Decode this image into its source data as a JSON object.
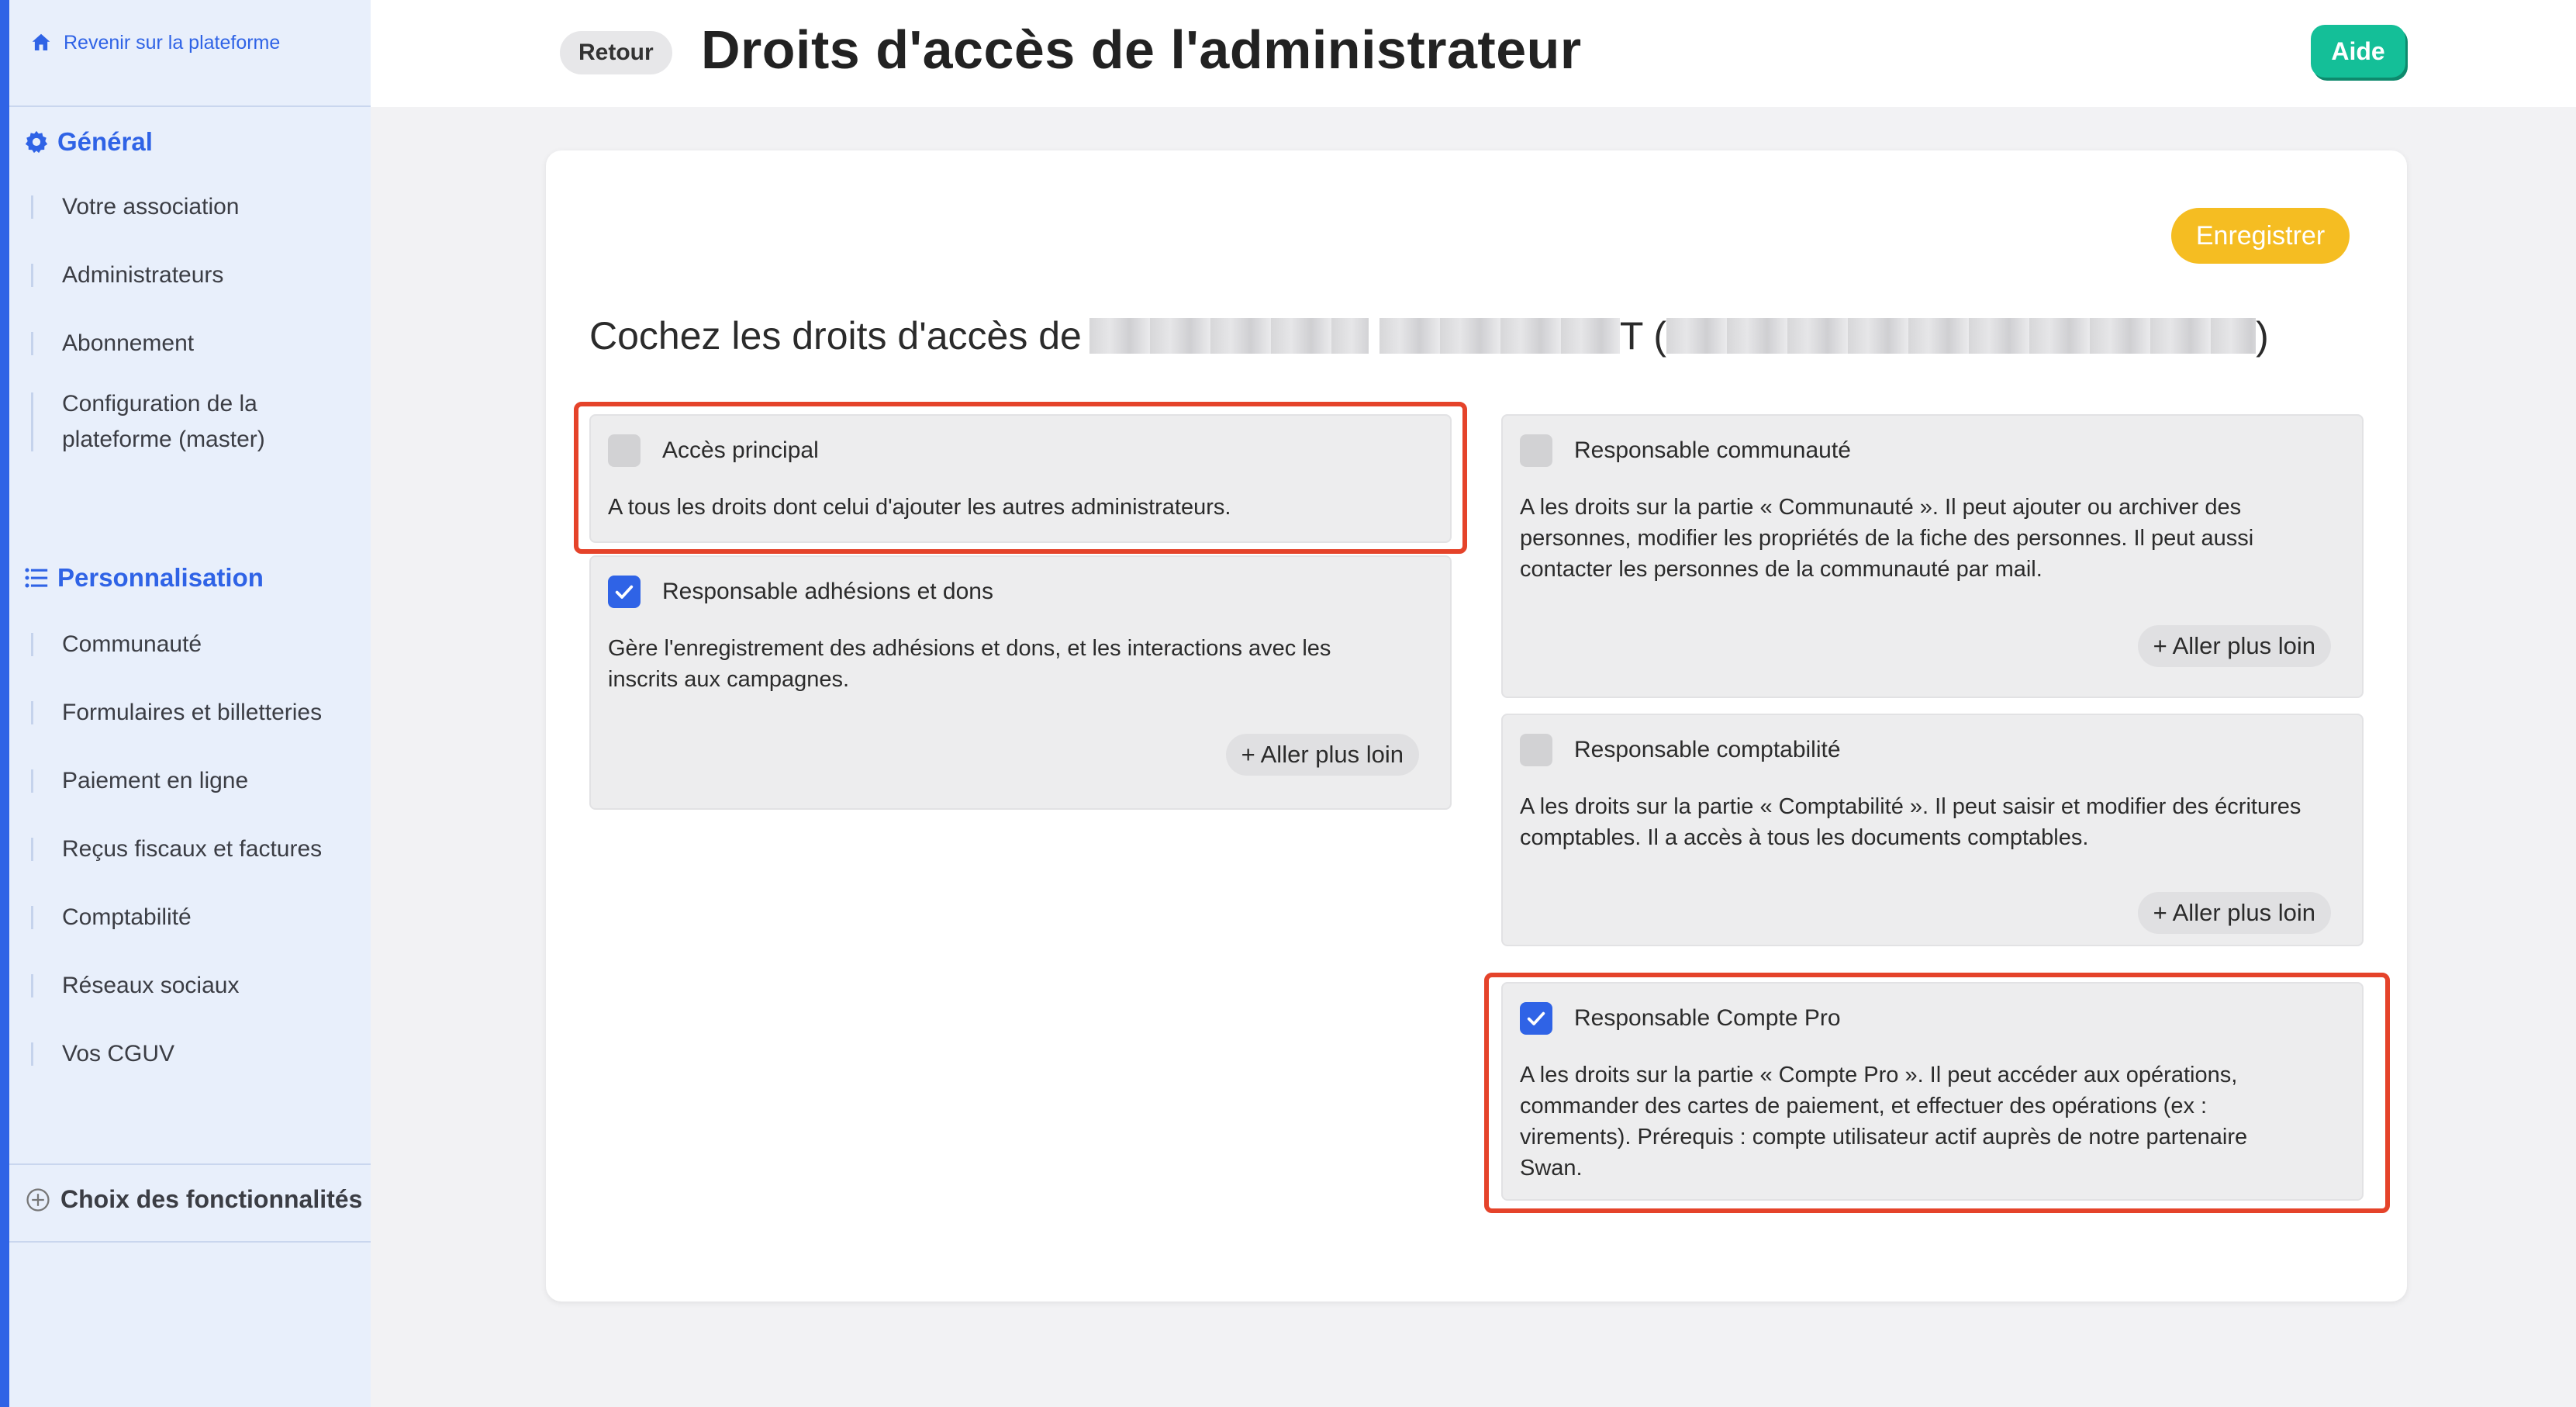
{
  "sidebar": {
    "back_link": "Revenir sur la plateforme",
    "sections": [
      {
        "title": "Général",
        "icon": "gear-icon",
        "items": [
          "Votre association",
          "Administrateurs",
          "Abonnement",
          "Configuration de la plateforme (master)"
        ]
      },
      {
        "title": "Personnalisation",
        "icon": "list-icon",
        "items": [
          "Communauté",
          "Formulaires et billetteries",
          "Paiement en ligne",
          "Reçus fiscaux et factures",
          "Comptabilité",
          "Réseaux sociaux",
          "Vos CGUV"
        ]
      }
    ],
    "features_label": "Choix des fonctionnalités"
  },
  "header": {
    "back_button": "Retour",
    "title": "Droits d'accès de l'administrateur",
    "help_button": "Aide"
  },
  "card": {
    "save_button": "Enregistrer",
    "heading_prefix": "Cochez les droits d'accès de",
    "heading_mid": "T (",
    "heading_suffix": ")",
    "more_label": "+ Aller plus loin",
    "permissions": [
      {
        "label": "Accès principal",
        "checked": false,
        "description": "A tous les droits dont celui d'ajouter les autres administrateurs."
      },
      {
        "label": "Responsable adhésions et dons",
        "checked": true,
        "description": "Gère l'enregistrement des adhésions et dons, et les interactions avec les inscrits aux campagnes."
      },
      {
        "label": "Responsable communauté",
        "checked": false,
        "description": "A les droits sur la partie « Communauté ». Il peut ajouter ou archiver des personnes, modifier les propriétés de la fiche des personnes. Il peut aussi contacter les personnes de la communauté par mail."
      },
      {
        "label": "Responsable comptabilité",
        "checked": false,
        "description": "A les droits sur la partie « Comptabilité ». Il peut saisir et modifier des écritures comptables. Il a accès à tous les documents comptables."
      },
      {
        "label": "Responsable Compte Pro",
        "checked": true,
        "description": "A les droits sur la partie « Compte Pro ». Il peut accéder aux opérations, commander des cartes de paiement, et effectuer des opérations (ex : virements). Prérequis : compte utilisateur actif auprès de notre partenaire Swan."
      }
    ]
  },
  "colors": {
    "accent": "#2f63e6",
    "help": "#14bf98",
    "save": "#f5bd22",
    "highlight": "#e5432a"
  }
}
